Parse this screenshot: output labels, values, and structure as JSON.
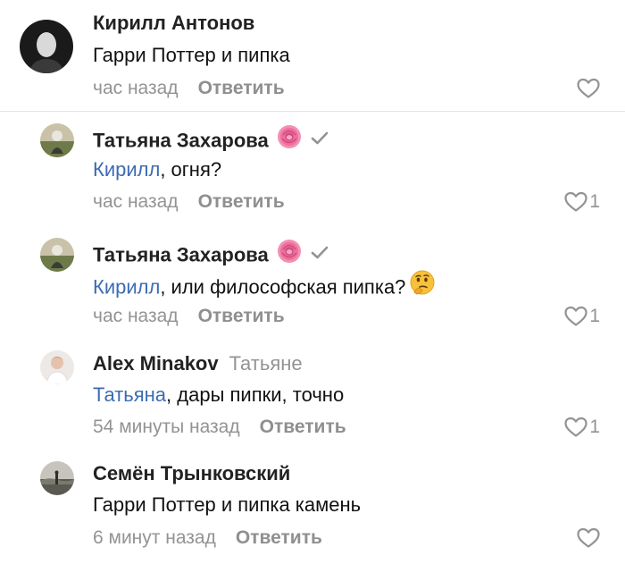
{
  "colors": {
    "mention": "#3d6bb3",
    "meta": "#939393",
    "author": "#222222"
  },
  "comments": [
    {
      "author": "Кирилл Антонов",
      "text": "Гарри Поттер и пипка",
      "time": "час назад",
      "reply_label": "Ответить",
      "likes": "",
      "avatar": "avatar-dark-portrait"
    },
    {
      "author": "Татьяна Захарова",
      "badges": [
        "rose-emoji",
        "verified-check-icon"
      ],
      "mention": "Кирилл",
      "text": ", огня?",
      "time": "час назад",
      "reply_label": "Ответить",
      "likes": "1",
      "avatar": "avatar-outdoor-photo"
    },
    {
      "author": "Татьяна Захарова",
      "badges": [
        "rose-emoji",
        "verified-check-icon"
      ],
      "mention": "Кирилл",
      "text": ", или философская пипка?",
      "emoji": "thinking-face-emoji",
      "time": "час назад",
      "reply_label": "Ответить",
      "likes": "1",
      "avatar": "avatar-outdoor-photo"
    },
    {
      "author": "Alex Minakov",
      "reply_to": "Татьяне",
      "mention": "Татьяна",
      "text": ", дары пипки, точно",
      "time": "54 минуты назад",
      "reply_label": "Ответить",
      "likes": "1",
      "avatar": "avatar-person-light"
    },
    {
      "author": "Семён Трынковский",
      "text": "Гарри Поттер и пипка камень",
      "time": "6 минут назад",
      "reply_label": "Ответить",
      "likes": "",
      "avatar": "avatar-landscape"
    }
  ]
}
